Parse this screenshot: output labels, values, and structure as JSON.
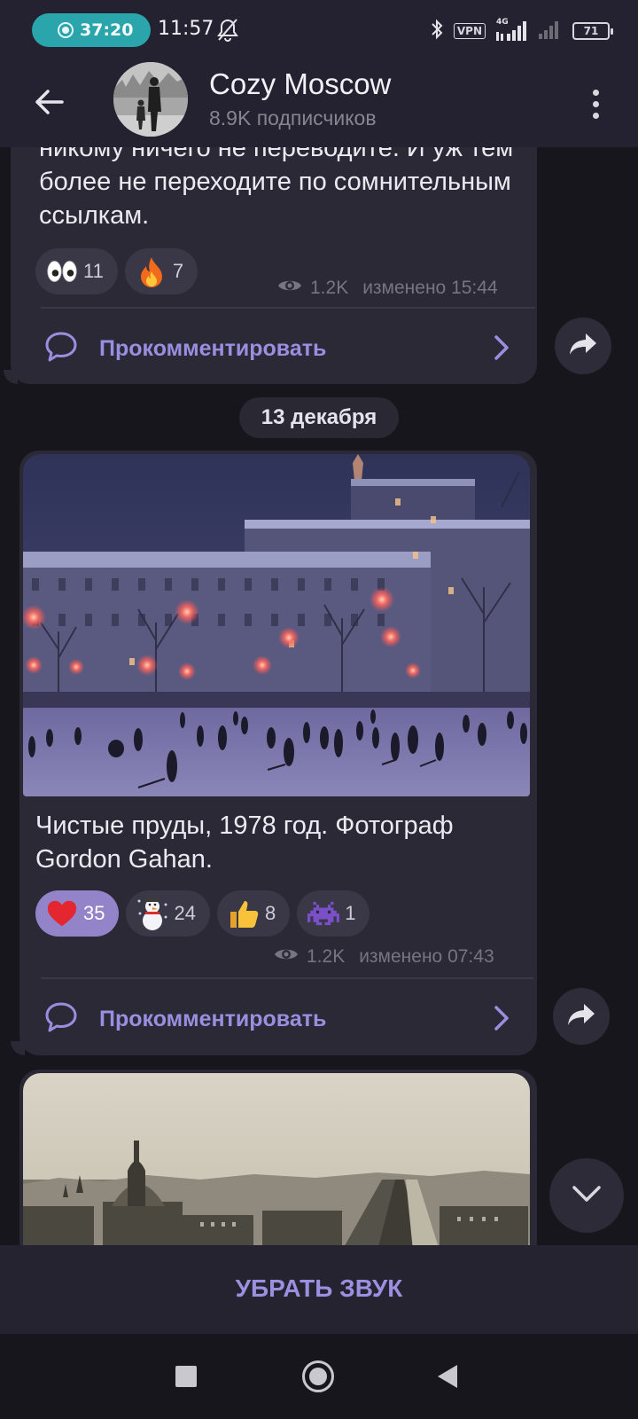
{
  "status_bar": {
    "recording_time": "37:20",
    "clock": "11:57",
    "vpn_label": "VPN",
    "network_label": "4G",
    "battery": "71"
  },
  "header": {
    "channel_name": "Cozy Moscow",
    "subscribers": "8.9K подписчиков"
  },
  "messages": [
    {
      "text": "никому ничего не переводите. И уж тем более не переходите по сомнительным ссылкам.",
      "reactions": [
        {
          "emoji": "eyes",
          "count": "11"
        },
        {
          "emoji": "fire",
          "count": "7"
        }
      ],
      "views": "1.2K",
      "edited": "изменено 15:44",
      "comment_label": "Прокомментировать"
    },
    {
      "text": "Чистые пруды, 1978 год. Фотограф Gordon Gahan.",
      "reactions": [
        {
          "emoji": "heart",
          "count": "35",
          "active": true
        },
        {
          "emoji": "snowman",
          "count": "24"
        },
        {
          "emoji": "thumbs-up",
          "count": "8"
        },
        {
          "emoji": "space-invader",
          "count": "1"
        }
      ],
      "views": "1.2K",
      "edited": "изменено 07:43",
      "comment_label": "Прокомментировать"
    }
  ],
  "date_separator": "13 декабря",
  "mute_button": "УБРАТЬ ЗВУК",
  "colors": {
    "accent": "#9b8fe0",
    "bubble": "#2b2935",
    "background": "#17161c",
    "header": "#242230",
    "recording_pill": "#2aa5ac"
  }
}
